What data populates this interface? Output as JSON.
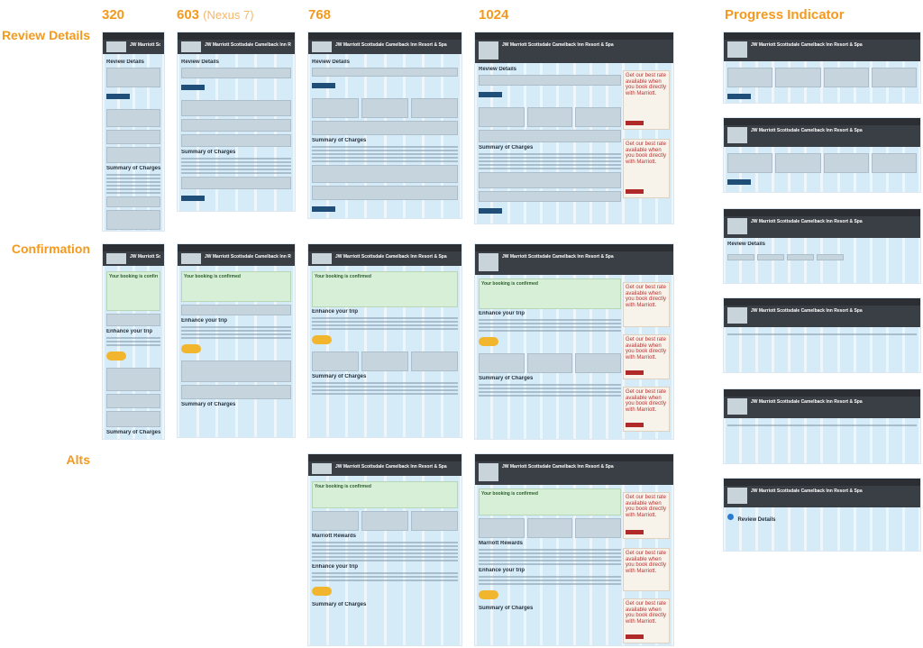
{
  "columns": [
    {
      "label": "320",
      "sub": ""
    },
    {
      "label": "603",
      "sub": "(Nexus 7)"
    },
    {
      "label": "768",
      "sub": ""
    },
    {
      "label": "1024",
      "sub": ""
    },
    {
      "label": "Progress Indicator",
      "sub": ""
    }
  ],
  "rows": [
    {
      "label": "Review Details"
    },
    {
      "label": "Confirmation"
    },
    {
      "label": "Alts"
    }
  ],
  "hotel_name": "JW Marriott Scottsdale Camelback Inn Resort & Spa",
  "mockup": {
    "review_title": "Review Details",
    "summary_title": "Summary of Charges",
    "confirmed_text": "Your booking is confirmed",
    "enhance_title": "Enhance your trip",
    "rewards_title": "Marriott Rewards",
    "ad_text": "Get our best rate available when you book directly with Marriott.",
    "progress_review": "Review Details"
  },
  "colors": {
    "header_accent": "#f39a1e",
    "grid_column": "#d6ebf8",
    "confirm_green": "#d7eed7",
    "ad_red": "#b12a2a"
  }
}
